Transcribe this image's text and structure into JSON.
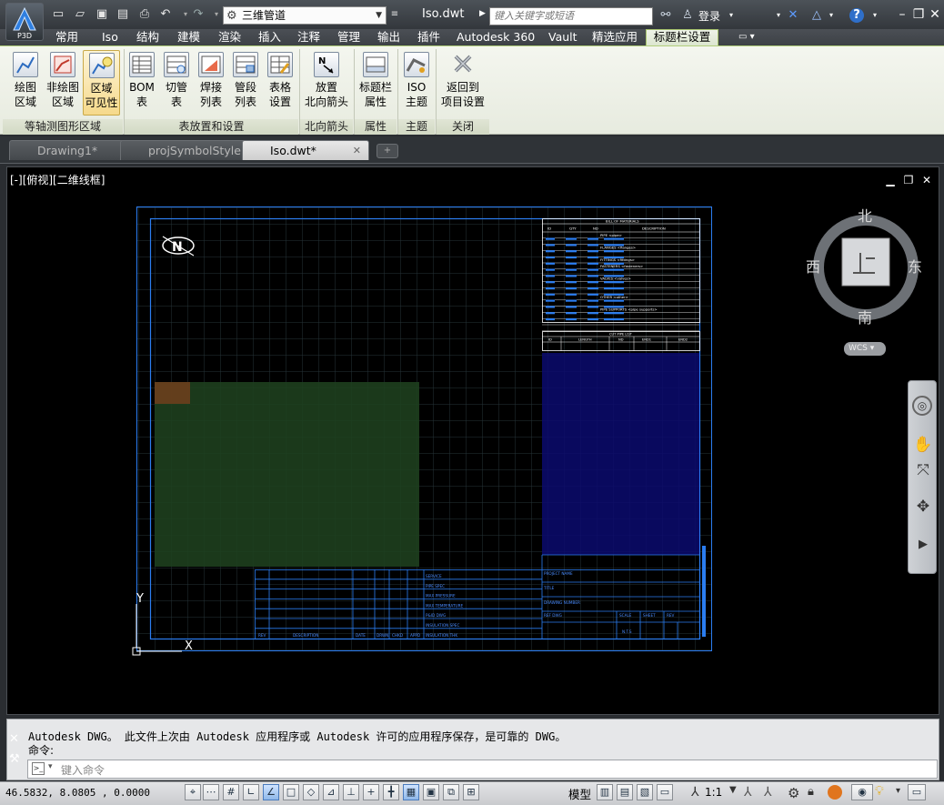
{
  "app": {
    "logo_text": "P3D"
  },
  "title_bar": {
    "workspace": "三维管道",
    "document_title": "Iso.dwt",
    "search_placeholder": "键入关键字或短语",
    "login": "登录"
  },
  "ribbon_tabs": [
    "常用",
    "Iso",
    "结构",
    "建模",
    "渲染",
    "插入",
    "注释",
    "管理",
    "输出",
    "插件",
    "Autodesk 360",
    "Vault",
    "精选应用",
    "标题栏设置"
  ],
  "active_tab": "标题栏设置",
  "ribbon": {
    "buttons": [
      {
        "l1": "绘图",
        "l2": "区域"
      },
      {
        "l1": "非绘图",
        "l2": "区域"
      },
      {
        "l1": "区域",
        "l2": "可见性"
      },
      {
        "l1": "BOM",
        "l2": "表"
      },
      {
        "l1": "切管",
        "l2": "表"
      },
      {
        "l1": "焊接",
        "l2": "列表"
      },
      {
        "l1": "管段",
        "l2": "列表"
      },
      {
        "l1": "表格",
        "l2": "设置"
      },
      {
        "l1": "放置",
        "l2": "北向箭头"
      },
      {
        "l1": "标题栏",
        "l2": "属性"
      },
      {
        "l1": "ISO",
        "l2": "主题"
      },
      {
        "l1": "返回到",
        "l2": "项目设置"
      }
    ],
    "panels": [
      "等轴测图形区域",
      "表放置和设置",
      "北向箭头",
      "属性",
      "主题",
      "关闭"
    ]
  },
  "doc_tabs": [
    "Drawing1*",
    "projSymbolStyle",
    "Iso.dwt*"
  ],
  "viewport": {
    "label": "[-][俯视][二维线框]",
    "viewcube": {
      "north": "北",
      "south": "南",
      "east": "东",
      "west": "西",
      "wcs": "WCS"
    }
  },
  "drawing": {
    "bom_title": "BILL OF MATERIALS",
    "bom_headers": [
      "ID",
      "QTY",
      "ND",
      "DESCRIPTION"
    ],
    "bom_sections": [
      "PIPE <pipe>",
      "FLANGES <flanges>",
      "FITTINGS <fittings>",
      "FASTENERS <fasteners>",
      "VALVES <valves>",
      "OTHER <other>",
      "PIPE SUPPORTS <pipe supports>"
    ],
    "cut_title": "CUT PIPE LIST",
    "cut_headers": [
      "ID",
      "LENGTH",
      "ND",
      "END1",
      "END2"
    ],
    "service_labels": [
      "SERVICE",
      "PIPE SPEC",
      "MAX PRESSURE",
      "MAX TEMPERATURE",
      "P&ID DWG",
      "INSULATION SPEC",
      "INSULATION THK"
    ],
    "rev_headers": [
      "REV",
      "DESCRIPTION",
      "DATE",
      "DRWN",
      "CHKD",
      "APPD"
    ],
    "title_block": [
      "PROJECT NAME",
      "TITLE",
      "DRAWING NUMBER",
      "REF DWG",
      "SCALE",
      "SHEET",
      "REV"
    ],
    "scale_value": "N.T.S",
    "north_letter": "N",
    "ucs_y": "Y",
    "ucs_x": "X"
  },
  "command": {
    "history1": "Autodesk DWG。  此文件上次由 Autodesk 应用程序或 Autodesk 许可的应用程序保存，是可靠的 DWG。",
    "history2": "命令:",
    "placeholder": "键入命令"
  },
  "status": {
    "coords": "46.5832, 8.0805 , 0.0000",
    "model": "模型",
    "scale": "1:1"
  }
}
